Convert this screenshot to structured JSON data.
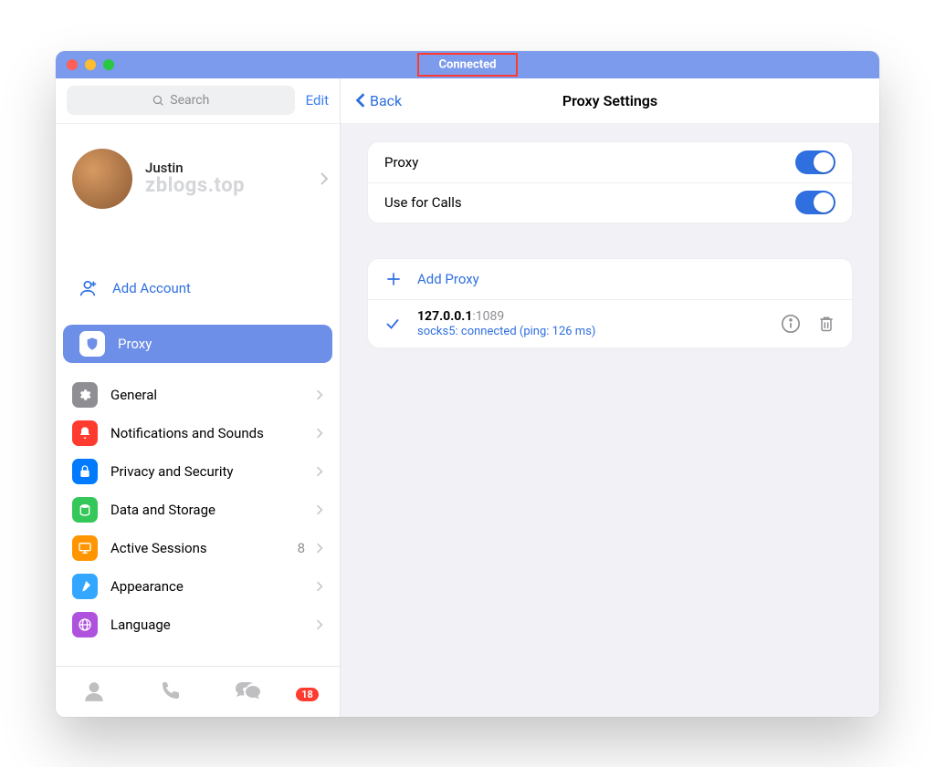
{
  "titlebar": {
    "status": "Connected"
  },
  "sidebar": {
    "search_placeholder": "Search",
    "edit": "Edit",
    "profile": {
      "name": "Justin",
      "subtitle": "zblogs.top"
    },
    "add_account": "Add Account",
    "items": [
      {
        "label": "Proxy"
      },
      {
        "label": "General"
      },
      {
        "label": "Notifications and Sounds"
      },
      {
        "label": "Privacy and Security"
      },
      {
        "label": "Data and Storage"
      },
      {
        "label": "Active Sessions",
        "badge": "8"
      },
      {
        "label": "Appearance"
      },
      {
        "label": "Language"
      }
    ],
    "tabbar_badge": "18"
  },
  "content": {
    "back": "Back",
    "title": "Proxy Settings",
    "switches": [
      {
        "label": "Proxy"
      },
      {
        "label": "Use for Calls"
      }
    ],
    "add_proxy": "Add Proxy",
    "proxy": {
      "host": "127.0.0.1",
      "port": ":1089",
      "status": "socks5: connected (ping: 126 ms)"
    }
  }
}
